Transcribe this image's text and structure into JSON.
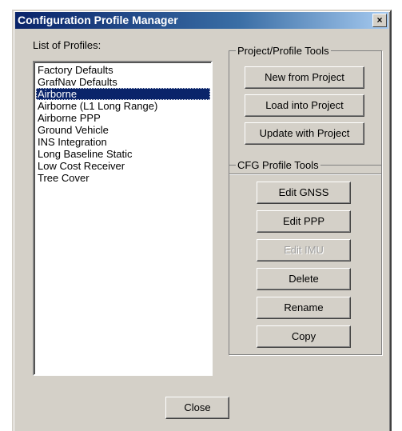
{
  "window": {
    "title": "Configuration Profile Manager",
    "close_glyph": "×"
  },
  "list": {
    "label": "List of Profiles:",
    "items": [
      "Factory Defaults",
      "GrafNav Defaults",
      "Airborne",
      "Airborne (L1 Long Range)",
      "Airborne PPP",
      "Ground Vehicle",
      "INS Integration",
      "Long Baseline Static",
      "Low Cost Receiver",
      "Tree Cover"
    ],
    "selected": "Airborne"
  },
  "project_tools": {
    "title": "Project/Profile Tools",
    "new_from_project": "New from Project",
    "load_into_project": "Load into Project",
    "update_with_project": "Update with Project"
  },
  "cfg_tools": {
    "title": "CFG Profile Tools",
    "edit_gnss": "Edit GNSS",
    "edit_ppp": "Edit PPP",
    "edit_imu": "Edit IMU",
    "delete": "Delete",
    "rename": "Rename",
    "copy": "Copy"
  },
  "footer": {
    "close": "Close"
  },
  "colors": {
    "title_bar": "#0a246a",
    "selection": "#0a246a",
    "face": "#d4d0c8"
  }
}
